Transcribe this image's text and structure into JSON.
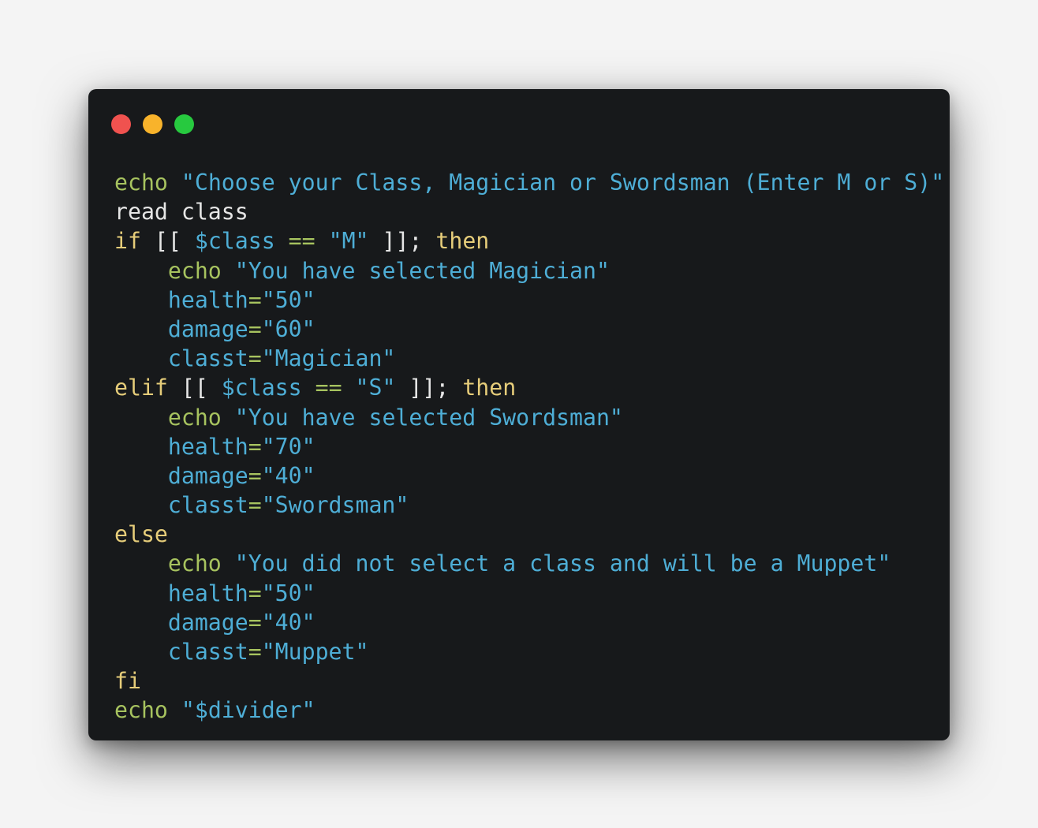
{
  "window": {
    "buttons": [
      {
        "name": "close-button",
        "color": "#f0524f"
      },
      {
        "name": "minimize-button",
        "color": "#f8b32b"
      },
      {
        "name": "maximize-button",
        "color": "#27c93f"
      }
    ]
  },
  "colors": {
    "background": "#17191b",
    "plain": "#e6e6e6",
    "builtin": "#a7c35f",
    "keyword": "#e6cd7a",
    "string": "#4eaed6"
  },
  "code": {
    "language": "bash",
    "lines": [
      [
        {
          "t": "builtin",
          "v": "echo"
        },
        {
          "t": "plain",
          "v": " "
        },
        {
          "t": "string",
          "v": "\"Choose your Class, Magician or Swordsman (Enter M or S)\""
        }
      ],
      [
        {
          "t": "plain",
          "v": "read class"
        }
      ],
      [
        {
          "t": "keyword",
          "v": "if"
        },
        {
          "t": "plain",
          "v": " [[ "
        },
        {
          "t": "variable",
          "v": "$class"
        },
        {
          "t": "plain",
          "v": " "
        },
        {
          "t": "operator",
          "v": "=="
        },
        {
          "t": "plain",
          "v": " "
        },
        {
          "t": "string",
          "v": "\"M\""
        },
        {
          "t": "plain",
          "v": " ]]; "
        },
        {
          "t": "keyword",
          "v": "then"
        }
      ],
      [
        {
          "t": "plain",
          "v": "    "
        },
        {
          "t": "builtin",
          "v": "echo"
        },
        {
          "t": "plain",
          "v": " "
        },
        {
          "t": "string",
          "v": "\"You have selected Magician\""
        }
      ],
      [
        {
          "t": "plain",
          "v": "    "
        },
        {
          "t": "variable",
          "v": "health"
        },
        {
          "t": "operator",
          "v": "="
        },
        {
          "t": "string",
          "v": "\"50\""
        }
      ],
      [
        {
          "t": "plain",
          "v": "    "
        },
        {
          "t": "variable",
          "v": "damage"
        },
        {
          "t": "operator",
          "v": "="
        },
        {
          "t": "string",
          "v": "\"60\""
        }
      ],
      [
        {
          "t": "plain",
          "v": "    "
        },
        {
          "t": "variable",
          "v": "classt"
        },
        {
          "t": "operator",
          "v": "="
        },
        {
          "t": "string",
          "v": "\"Magician\""
        }
      ],
      [
        {
          "t": "keyword",
          "v": "elif"
        },
        {
          "t": "plain",
          "v": " [[ "
        },
        {
          "t": "variable",
          "v": "$class"
        },
        {
          "t": "plain",
          "v": " "
        },
        {
          "t": "operator",
          "v": "=="
        },
        {
          "t": "plain",
          "v": " "
        },
        {
          "t": "string",
          "v": "\"S\""
        },
        {
          "t": "plain",
          "v": " ]]; "
        },
        {
          "t": "keyword",
          "v": "then"
        }
      ],
      [
        {
          "t": "plain",
          "v": "    "
        },
        {
          "t": "builtin",
          "v": "echo"
        },
        {
          "t": "plain",
          "v": " "
        },
        {
          "t": "string",
          "v": "\"You have selected Swordsman\""
        }
      ],
      [
        {
          "t": "plain",
          "v": "    "
        },
        {
          "t": "variable",
          "v": "health"
        },
        {
          "t": "operator",
          "v": "="
        },
        {
          "t": "string",
          "v": "\"70\""
        }
      ],
      [
        {
          "t": "plain",
          "v": "    "
        },
        {
          "t": "variable",
          "v": "damage"
        },
        {
          "t": "operator",
          "v": "="
        },
        {
          "t": "string",
          "v": "\"40\""
        }
      ],
      [
        {
          "t": "plain",
          "v": "    "
        },
        {
          "t": "variable",
          "v": "classt"
        },
        {
          "t": "operator",
          "v": "="
        },
        {
          "t": "string",
          "v": "\"Swordsman\""
        }
      ],
      [
        {
          "t": "keyword",
          "v": "else"
        }
      ],
      [
        {
          "t": "plain",
          "v": "    "
        },
        {
          "t": "builtin",
          "v": "echo"
        },
        {
          "t": "plain",
          "v": " "
        },
        {
          "t": "string",
          "v": "\"You did not select a class and will be a Muppet\""
        }
      ],
      [
        {
          "t": "plain",
          "v": "    "
        },
        {
          "t": "variable",
          "v": "health"
        },
        {
          "t": "operator",
          "v": "="
        },
        {
          "t": "string",
          "v": "\"50\""
        }
      ],
      [
        {
          "t": "plain",
          "v": "    "
        },
        {
          "t": "variable",
          "v": "damage"
        },
        {
          "t": "operator",
          "v": "="
        },
        {
          "t": "string",
          "v": "\"40\""
        }
      ],
      [
        {
          "t": "plain",
          "v": "    "
        },
        {
          "t": "variable",
          "v": "classt"
        },
        {
          "t": "operator",
          "v": "="
        },
        {
          "t": "string",
          "v": "\"Muppet\""
        }
      ],
      [
        {
          "t": "keyword",
          "v": "fi"
        }
      ],
      [
        {
          "t": "builtin",
          "v": "echo"
        },
        {
          "t": "plain",
          "v": " "
        },
        {
          "t": "string",
          "v": "\"$divider\""
        }
      ]
    ]
  }
}
